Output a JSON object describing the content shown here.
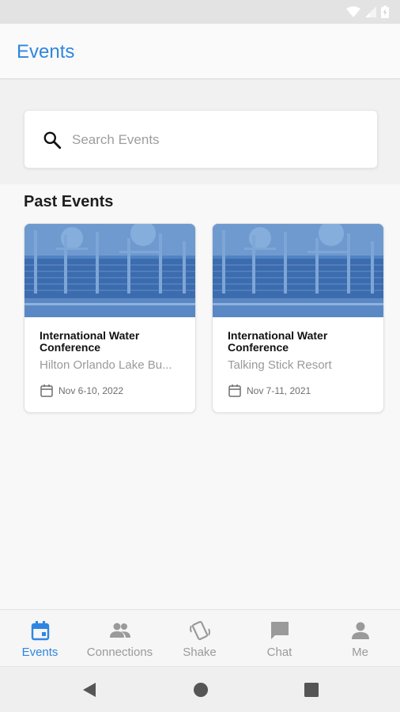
{
  "status_bar": {
    "icons": [
      "wifi-icon",
      "signal-icon",
      "battery-icon"
    ]
  },
  "app_bar": {
    "title": "Events"
  },
  "search": {
    "placeholder": "Search Events",
    "value": ""
  },
  "past_events": {
    "title": "Past Events",
    "items": [
      {
        "title": "International Water Conference",
        "venue": "Hilton Orlando Lake Bu...",
        "date": "Nov  6-10, 2022"
      },
      {
        "title": "International Water Conference",
        "venue": "Talking Stick Resort",
        "date": "Nov  7-11, 2021"
      }
    ]
  },
  "bottom_nav": {
    "items": [
      {
        "label": "Events",
        "icon": "calendar-icon",
        "active": true
      },
      {
        "label": "Connections",
        "icon": "people-icon",
        "active": false
      },
      {
        "label": "Shake",
        "icon": "shake-phone-icon",
        "active": false
      },
      {
        "label": "Chat",
        "icon": "chat-bubble-icon",
        "active": false
      },
      {
        "label": "Me",
        "icon": "person-icon",
        "active": false
      }
    ]
  },
  "colors": {
    "accent": "#2f86e0",
    "inactive": "#9a9a9a",
    "card_image_overlay": "#3d74b8"
  }
}
